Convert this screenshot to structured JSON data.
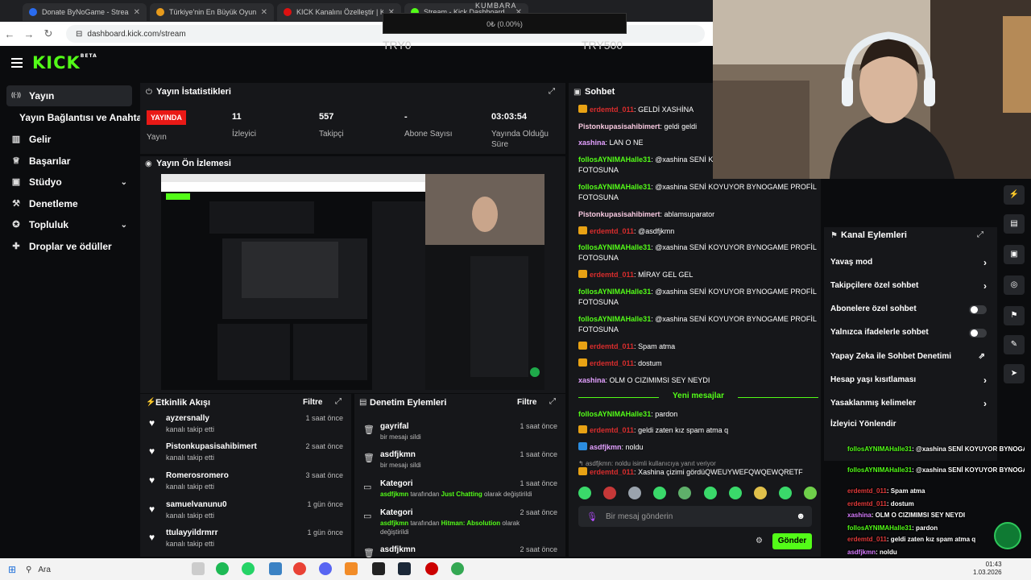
{
  "browser": {
    "tabs": [
      {
        "title": "Donate ByNoGame - Streamer",
        "color": "#2a6cf0"
      },
      {
        "title": "Türkiye'nin En Büyük Oyuncu Ö...",
        "color": "#e89b1c"
      },
      {
        "title": "KICK Kanalını Özelleştir | Kick H...",
        "color": "#d11"
      },
      {
        "title": "Stream - Kick Dashboard",
        "color": "#53fc18"
      }
    ],
    "url": "dashboard.kick.com/stream"
  },
  "overlay_goal": {
    "label": "KUMBARA",
    "value": "0₺ (0.00%)",
    "min": "TRY0",
    "max": "TRY500"
  },
  "brand": {
    "logo": "KICK",
    "beta": "BETA",
    "accent": "#53fc18"
  },
  "sidebar": {
    "items": [
      {
        "label": "Yayın",
        "icon": "broadcast-icon",
        "glyph": "((·))",
        "active": true
      },
      {
        "label": "Yayın Bağlantısı ve Anahtarı",
        "icon": "",
        "glyph": ""
      },
      {
        "label": "Gelir",
        "icon": "chart-icon",
        "glyph": "▥"
      },
      {
        "label": "Başarılar",
        "icon": "trophy-icon",
        "glyph": "♕"
      },
      {
        "label": "Stüdyo",
        "icon": "camera-icon",
        "glyph": "▣",
        "chevron": "⌄"
      },
      {
        "label": "Denetleme",
        "icon": "hammer-icon",
        "glyph": "⚒"
      },
      {
        "label": "Topluluk",
        "icon": "community-icon",
        "glyph": "✪",
        "chevron": "⌄"
      },
      {
        "label": "Droplar ve ödüller",
        "icon": "gift-icon",
        "glyph": "✚"
      }
    ]
  },
  "stats": {
    "title": "Yayın İstatistikleri",
    "live": "YAYINDA",
    "live_label": "Yayın",
    "viewers": "11",
    "viewers_label": "İzleyici",
    "followers": "557",
    "followers_label": "Takipçi",
    "subs": "-",
    "subs_label": "Abone Sayısı",
    "uptime": "03:03:54",
    "uptime_label": "Yayında Olduğu Süre"
  },
  "preview": {
    "title": "Yayın Ön İzlemesi"
  },
  "activity": {
    "title": "Etkinlik Akışı",
    "filter": "Filtre",
    "items": [
      {
        "name": "ayzersnally",
        "sub": "kanalı takip etti",
        "time": "1 saat önce"
      },
      {
        "name": "Pistonkupasisahibimert",
        "sub": "kanalı takip etti",
        "time": "2 saat önce"
      },
      {
        "name": "Romerosromero",
        "sub": "kanalı takip etti",
        "time": "3 saat önce"
      },
      {
        "name": "samuelvanunu0",
        "sub": "kanalı takip etti",
        "time": "1 gün önce"
      },
      {
        "name": "ttulayyildrmrr",
        "sub": "kanalı takip etti",
        "time": "1 gün önce"
      }
    ]
  },
  "mod": {
    "title": "Denetim Eylemleri",
    "filter": "Filtre",
    "items": [
      {
        "name": "gayrifal",
        "sub_pre": "bir mesajı sildi",
        "time": "1 saat önce",
        "icon": "trash-icon"
      },
      {
        "name": "asdfjkmn",
        "sub_pre": "bir mesajı sildi",
        "time": "1 saat önce",
        "icon": "trash-icon"
      },
      {
        "name": "Kategori",
        "sub_user": "asdfjkmn",
        "sub_pre": "tarafından",
        "sub_cat": "Just Chatting",
        "sub_post": "olarak değiştirildi",
        "time": "1 saat önce",
        "icon": "category-icon"
      },
      {
        "name": "Kategori",
        "sub_user": "asdfjkmn",
        "sub_pre": "tarafından",
        "sub_cat": "Hitman: Absolution",
        "sub_post": "olarak değiştirildi",
        "time": "2 saat önce",
        "icon": "category-icon"
      },
      {
        "name": "asdfjkmn",
        "sub_pre": "",
        "time": "2 saat önce",
        "icon": "trash-icon"
      }
    ]
  },
  "chat": {
    "title": "Sohbet",
    "messages": [
      {
        "user": "erdemtd_011",
        "cls": "r",
        "badge": "crown",
        "text": "GELDİ XASHİNA"
      },
      {
        "user": "Pistonkupasisahibimert",
        "cls": "w",
        "badge": "",
        "text": "geldi geldi"
      },
      {
        "user": "xashina",
        "cls": "p",
        "badge": "",
        "text": "LAN O NE"
      },
      {
        "user": "follosAYNIMAHalle31",
        "cls": "g",
        "badge": "",
        "text": "@xashina SENİ KOYUYOR BYNOGAME PROFİL FOTOSUNA"
      },
      {
        "user": "follosAYNIMAHalle31",
        "cls": "g",
        "badge": "",
        "text": "@xashina SENİ KOYUYOR BYNOGAME PROFİL FOTOSUNA"
      },
      {
        "user": "Pistonkupasisahibimert",
        "cls": "w",
        "badge": "",
        "text": "ablamsuparator"
      },
      {
        "user": "erdemtd_011",
        "cls": "r",
        "badge": "crown",
        "text": "@asdfjkmn"
      },
      {
        "user": "follosAYNIMAHalle31",
        "cls": "g",
        "badge": "",
        "text": "@xashina SENİ KOYUYOR BYNOGAME PROFİL FOTOSUNA"
      },
      {
        "user": "erdemtd_011",
        "cls": "r",
        "badge": "crown",
        "text": "MİRAY GEL GEL"
      },
      {
        "user": "follosAYNIMAHalle31",
        "cls": "g",
        "badge": "",
        "text": "@xashina SENİ KOYUYOR BYNOGAME PROFİL FOTOSUNA"
      },
      {
        "user": "follosAYNIMAHalle31",
        "cls": "g",
        "badge": "",
        "text": "@xashina SENİ KOYUYOR BYNOGAME PROFİL FOTOSUNA"
      },
      {
        "user": "erdemtd_011",
        "cls": "r",
        "badge": "crown",
        "text": "Spam atma"
      },
      {
        "user": "erdemtd_011",
        "cls": "r",
        "badge": "crown",
        "text": "dostum"
      },
      {
        "user": "xashina",
        "cls": "p",
        "badge": "",
        "text": "OLM O CIZIMIMSI SEY NEYDI"
      }
    ],
    "new_messages": "Yeni mesajlar",
    "after": [
      {
        "user": "follosAYNIMAHalle31",
        "cls": "g",
        "badge": "",
        "text": "pardon"
      },
      {
        "user": "erdemtd_011",
        "cls": "r",
        "badge": "crown",
        "text": "geldi zaten kız spam atma q"
      },
      {
        "user": "asdfjkmn",
        "cls": "p",
        "badge": "pen",
        "text": "noldu"
      }
    ],
    "reply_note": "asdfjkmn: noldu isimli kullanıcıya yanıt veriyor",
    "reply_line": {
      "user": "erdemtd_011",
      "text": "Xashina çizimi gördüQWEUYWEFQWQEWQRETF"
    },
    "input_placeholder": "Bir mesaj gönderin",
    "send": "Gönder"
  },
  "channel_events": {
    "title": "Kanal Eylemleri",
    "rows": [
      {
        "label": "Yavaş mod",
        "kind": "chevron"
      },
      {
        "label": "Takipçilere özel sohbet",
        "kind": "chevron"
      },
      {
        "label": "Abonelere özel sohbet",
        "kind": "toggle"
      },
      {
        "label": "Yalnızca ifadelerle sohbet",
        "kind": "toggle"
      },
      {
        "label": "Yapay Zeka ile Sohbet Denetimi",
        "kind": "external"
      },
      {
        "label": "Hesap yaşı kısıtlaması",
        "kind": "chevron"
      },
      {
        "label": "Yasaklanmış kelimeler",
        "kind": "chevron"
      },
      {
        "label": "İzleyici Yönlendir",
        "kind": "none"
      }
    ]
  },
  "overlay_chat": [
    {
      "user": "follosAYNIMAHalle31",
      "cls": "g",
      "text": ": @xashina SENİ KOYUYOR BYNOGAME PROFİL FOTOSUNA"
    },
    {
      "user": "follosAYNIMAHalle31",
      "cls": "g",
      "text": ": @xashina SENİ KOYUYOR BYNOGAME PROFİL FOTOSUNA"
    },
    {
      "user": "erdemtd_011",
      "cls": "r",
      "text": ": Spam atma"
    },
    {
      "user": "erdemtd_011",
      "cls": "r",
      "text": ": dostum"
    },
    {
      "user": "xashina",
      "cls": "p",
      "text": ": OLM O CIZIMIMSI SEY NEYDI"
    },
    {
      "user": "follosAYNIMAHalle31",
      "cls": "g",
      "text": ": pardon"
    },
    {
      "user": "erdemtd_011",
      "cls": "r",
      "text": ": geldi zaten kız spam atma q"
    },
    {
      "user": "asdfjkmn",
      "cls": "p",
      "text": ": noldu"
    }
  ],
  "taskbar": {
    "search": "Ara",
    "time": "01:43",
    "date": "1.03.2026"
  }
}
